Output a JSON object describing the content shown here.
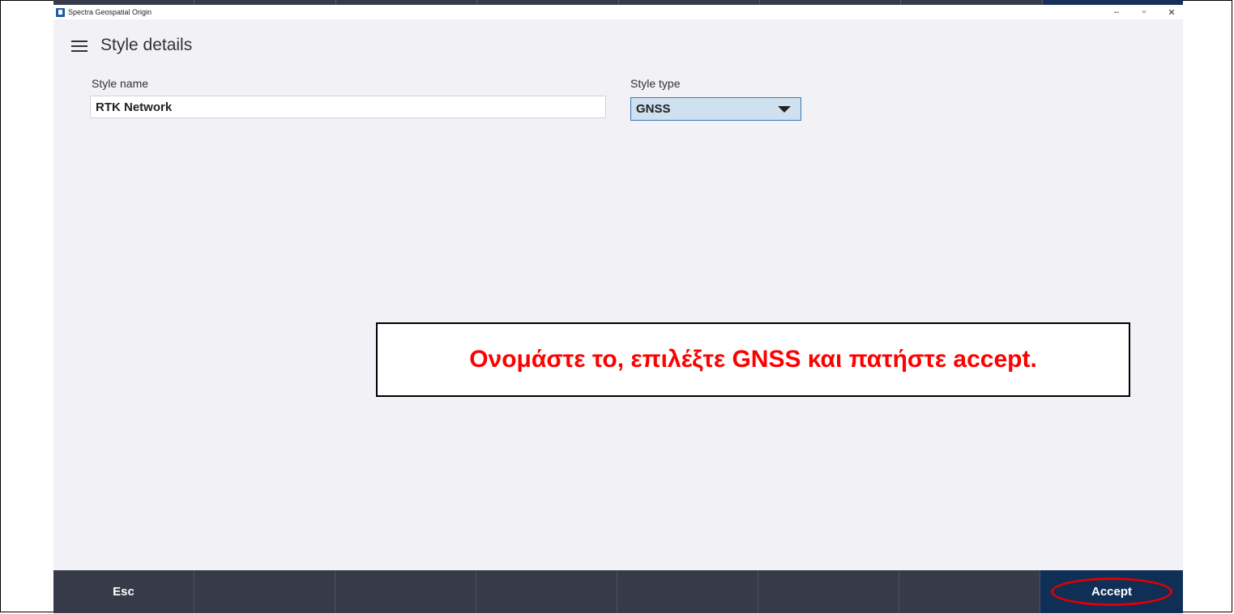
{
  "window": {
    "title": "Spectra Geospatial Origin",
    "controls": {
      "minimize": "–",
      "restore": "▫",
      "close": "✕"
    }
  },
  "header": {
    "menu_icon": "hamburger-menu-icon",
    "title": "Style details"
  },
  "form": {
    "style_name_label": "Style name",
    "style_name_value": "RTK Network",
    "style_type_label": "Style type",
    "style_type_value": "GNSS"
  },
  "annotation": {
    "text": "Ονομάστε το, επιλέξτε GNSS και πατήστε accept.",
    "color": "#ff0000"
  },
  "footer": {
    "esc_label": "Esc",
    "accept_label": "Accept",
    "highlight_color": "#e00000"
  },
  "colors": {
    "app_background": "#f1f1f6",
    "footer_background": "#373a48",
    "accept_background": "#0f2f56",
    "select_background": "#cfe0ef"
  }
}
